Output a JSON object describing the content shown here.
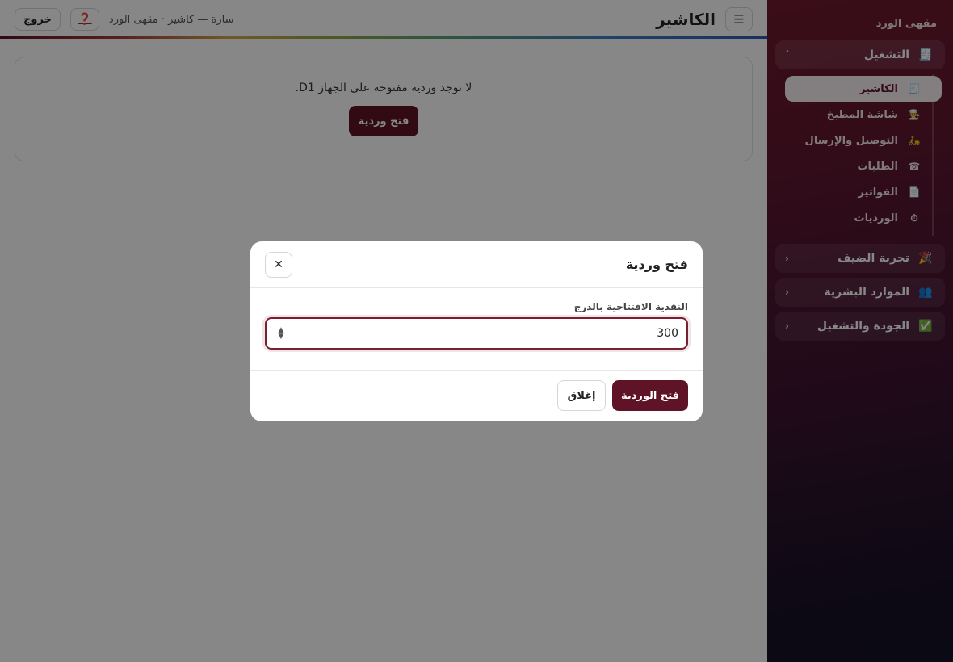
{
  "sidebar": {
    "brand": "مقهى الورد",
    "groups": [
      {
        "label": "التشغيل",
        "icon": "🧾",
        "chevron": "˄",
        "items": [
          {
            "label": "الكاشير",
            "icon": "🧾"
          },
          {
            "label": "شاشة المطبخ",
            "icon": "👨‍🍳"
          },
          {
            "label": "التوصيل والإرسال",
            "icon": "🛵"
          },
          {
            "label": "الطلبات",
            "icon": "☎"
          },
          {
            "label": "الفواتير",
            "icon": "📄"
          },
          {
            "label": "الورديات",
            "icon": "⏱"
          }
        ]
      },
      {
        "label": "تجربة الضيف",
        "icon": "🎉",
        "chevron": "‹"
      },
      {
        "label": "الموارد البشرية",
        "icon": "👥",
        "chevron": "‹"
      },
      {
        "label": "الجودة والتشغيل",
        "icon": "✅",
        "chevron": "‹"
      }
    ]
  },
  "header": {
    "menu_icon": "☰",
    "title": "الكاشير",
    "user_info": "سارة — كاشير · مقهى الورد",
    "help_icon": "❓",
    "logout_label": "خروج"
  },
  "card": {
    "message": "لا توجد وردية مفتوحة على الجهاز D1.",
    "button_label": "فتح وردية"
  },
  "modal": {
    "title": "فتح وردية",
    "close_icon": "✕",
    "field_label": "النقدية الافتتاحية بالدرج",
    "field_value": "300",
    "stepper_up": "▲",
    "stepper_down": "▼",
    "confirm_label": "فتح الوردية",
    "cancel_label": "إغلاق"
  },
  "colors": {
    "brand": "#5e1327",
    "overlay": "rgba(0,0,0,0.47)"
  }
}
